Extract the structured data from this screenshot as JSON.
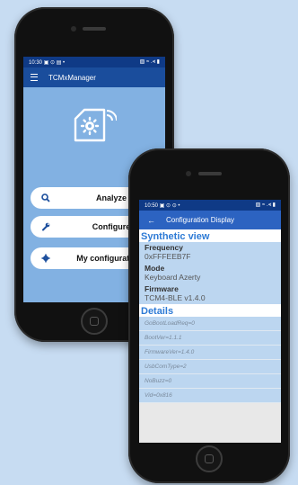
{
  "phone1": {
    "status": {
      "time": "10:30",
      "left_icons": "▣ ⊙ ▤ •",
      "right_icons": "▧ ≈ .⪡ ▮"
    },
    "app_title": "TCMxManager",
    "buttons": [
      {
        "label": "Analyze",
        "icon": "search-icon"
      },
      {
        "label": "Configure",
        "icon": "wrench-icon"
      },
      {
        "label": "My configurations",
        "icon": "gear-icon"
      }
    ]
  },
  "phone2": {
    "status": {
      "time": "10:50",
      "left_icons": "▣ ⊙ ⊙ •",
      "right_icons": "▧ ≈ .⪡ ▮"
    },
    "title": "Configuration Display",
    "synthetic": {
      "heading": "Synthetic view",
      "fields": [
        {
          "label": "Frequency",
          "value": "0xFFFEEB7F"
        },
        {
          "label": "Mode",
          "value": "Keyboard Azerty"
        },
        {
          "label": "Firmware",
          "value": "TCM4-BLE v1.4.0"
        }
      ]
    },
    "details": {
      "heading": "Details",
      "rows": [
        "GoBootLoadReq=0",
        "BootVer=1.1.1",
        "FirmwareVer=1.4.0",
        "UsbComType=2",
        "NoBuzz=0",
        "Vid=0x816"
      ]
    }
  },
  "colors": {
    "background": "#c7dcf2",
    "appbar": "#1a4d9c",
    "accent": "#2e7bd6"
  }
}
